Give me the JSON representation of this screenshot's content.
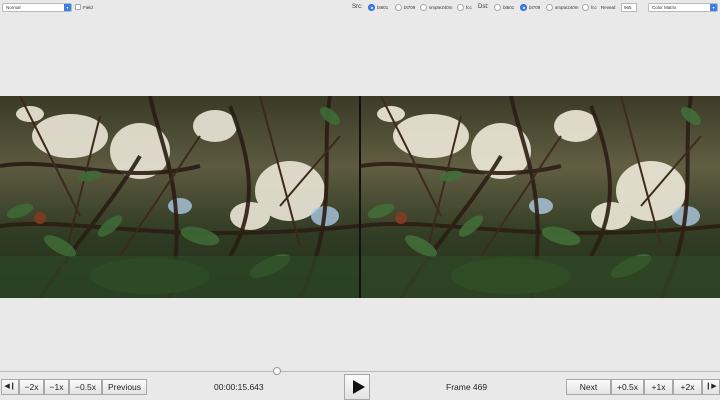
{
  "toolbar": {
    "mode_value": "Normal",
    "field_label": "Field",
    "src_label": "Src:",
    "dst_label": "Dst:",
    "options": [
      "bt601",
      "bt709",
      "smpte240m",
      "fcc"
    ],
    "src_selected": "bt601",
    "dst_selected": "bt709",
    "reveal_label": "Reveal:",
    "reveal_value": "965",
    "matrix_value": "Color Matrix"
  },
  "controls": {
    "step_back_icon": "step-back-icon",
    "back_2x": "−2x",
    "back_1x": "−1x",
    "back_half": "−0.5x",
    "previous": "Previous",
    "timecode": "00:00:15.643",
    "play_icon": "play-icon",
    "frame_label": "Frame 469",
    "next": "Next",
    "fwd_half": "+0.5x",
    "fwd_1x": "+1x",
    "fwd_2x": "+2x",
    "step_forward_icon": "step-forward-icon",
    "scrubber_position": 0.385
  },
  "colors": {
    "accent": "#3b7ee8",
    "background": "#e9e9e9"
  }
}
